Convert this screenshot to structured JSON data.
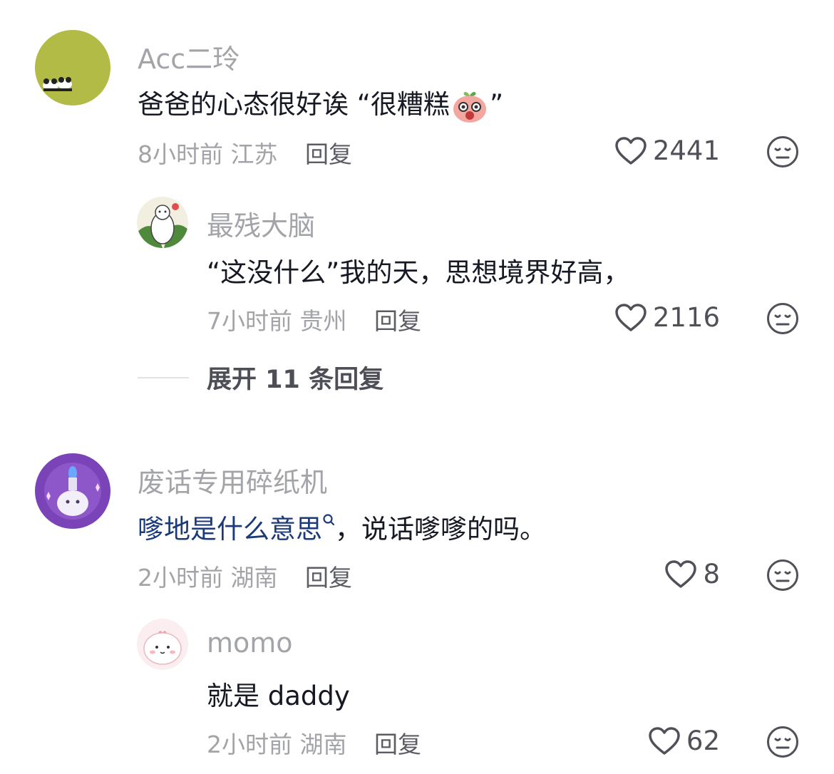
{
  "comments": [
    {
      "user": "Acc二玲",
      "content_before": "爸爸的心态很好诶 “很糟糕",
      "content_after": "”",
      "inline_emoji": "shocked-peach-emoji",
      "time": "8小时前",
      "location": "江苏",
      "reply_label": "回复",
      "likes": "2441",
      "replies": [
        {
          "user": "最残大脑",
          "content": "“这没什么”我的天，思想境界好高，",
          "time": "7小时前",
          "location": "贵州",
          "reply_label": "回复",
          "likes": "2116"
        }
      ],
      "expand_label": "展开 11 条回复"
    },
    {
      "user": "废话专用碎纸机",
      "content_keyword": "嗲地是什么意思",
      "content_after": "，说话嗲嗲的吗。",
      "time": "2小时前",
      "location": "湖南",
      "reply_label": "回复",
      "likes": "8",
      "replies": [
        {
          "user": "momo",
          "content": "就是 daddy",
          "time": "2小时前",
          "location": "湖南",
          "reply_label": "回复",
          "likes": "62"
        }
      ]
    }
  ],
  "icons": {
    "like": "heart-outline-icon",
    "dislike": "neutral-face-icon",
    "search": "search-icon"
  },
  "colors": {
    "keyword": "#1b3a7a",
    "meta": "#a3a4a9",
    "text": "#161823"
  }
}
